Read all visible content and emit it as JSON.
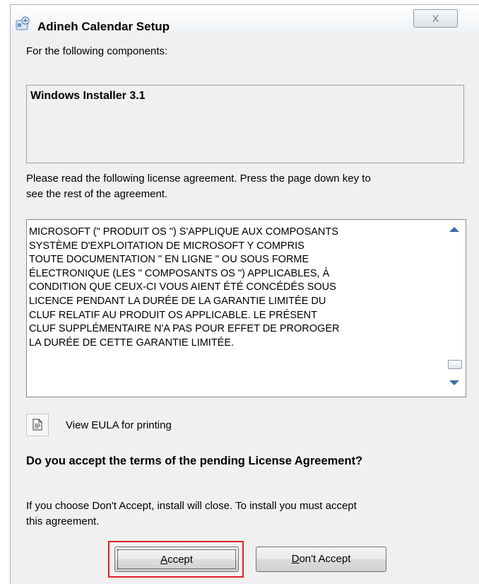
{
  "window": {
    "title": "Adineh Calendar Setup",
    "close_glyph": "X"
  },
  "intro": "For the following components:",
  "components": [
    "Windows Installer 3.1"
  ],
  "instructions": {
    "line1": "Please read the following license agreement. Press the page down key to",
    "line2": "see the rest of the agreement."
  },
  "eula_text": "MICROSOFT (\" PRODUIT OS \") S'APPLIQUE AUX COMPOSANTS\nSYSTÈME D'EXPLOITATION DE MICROSOFT Y COMPRIS\nTOUTE DOCUMENTATION \" EN LIGNE \" OU SOUS FORME\nÉLECTRONIQUE (LES \" COMPOSANTS OS \") APPLICABLES, À\nCONDITION QUE CEUX-CI VOUS AIENT ÉTÉ CONCÉDÉS SOUS\nLICENCE PENDANT LA DURÉE DE LA GARANTIE LIMITÉE DU\nCLUF RELATIF AU PRODUIT OS APPLICABLE. LE PRÉSENT\nCLUF SUPPLÉMENTAIRE N'A PAS POUR EFFET DE PROROGER\nLA DURÉE DE CETTE GARANTIE LIMITÉE.",
  "view_eula": {
    "label": "View EULA for printing",
    "icon": "document-icon"
  },
  "question": "Do you accept the terms of the pending License Agreement?",
  "notice": {
    "line1": "If you choose Don't Accept, install will close. To install you must accept",
    "line2": "this agreement."
  },
  "buttons": {
    "accept_mnemonic": "A",
    "accept_rest": "ccept",
    "decline_mnemonic": "D",
    "decline_rest": "on't Accept"
  },
  "colors": {
    "focus_highlight": "#e0202a",
    "scroll_arrow": "#3a6ea8"
  }
}
